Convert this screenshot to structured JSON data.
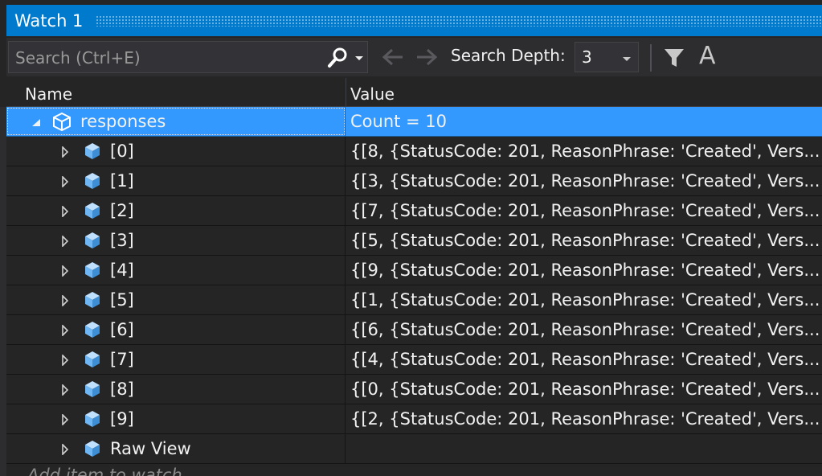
{
  "window": {
    "title": "Watch 1"
  },
  "toolbar": {
    "search_placeholder": "Search (Ctrl+E)",
    "search_value": "",
    "search_depth_label": "Search Depth:",
    "search_depth_value": "3"
  },
  "columns": {
    "name": "Name",
    "value": "Value"
  },
  "root": {
    "name": "responses",
    "value": "Count = 10"
  },
  "items": [
    {
      "name": "[0]",
      "value": "{[8, {StatusCode: 201, ReasonPhrase: 'Created', Vers..."
    },
    {
      "name": "[1]",
      "value": "{[3, {StatusCode: 201, ReasonPhrase: 'Created', Vers..."
    },
    {
      "name": "[2]",
      "value": "{[7, {StatusCode: 201, ReasonPhrase: 'Created', Vers..."
    },
    {
      "name": "[3]",
      "value": "{[5, {StatusCode: 201, ReasonPhrase: 'Created', Vers..."
    },
    {
      "name": "[4]",
      "value": "{[9, {StatusCode: 201, ReasonPhrase: 'Created', Vers..."
    },
    {
      "name": "[5]",
      "value": "{[1, {StatusCode: 201, ReasonPhrase: 'Created', Vers..."
    },
    {
      "name": "[6]",
      "value": "{[6, {StatusCode: 201, ReasonPhrase: 'Created', Vers..."
    },
    {
      "name": "[7]",
      "value": "{[4, {StatusCode: 201, ReasonPhrase: 'Created', Vers..."
    },
    {
      "name": "[8]",
      "value": "{[0, {StatusCode: 201, ReasonPhrase: 'Created', Vers..."
    },
    {
      "name": "[9]",
      "value": "{[2, {StatusCode: 201, ReasonPhrase: 'Created', Vers..."
    }
  ],
  "raw_view": {
    "name": "Raw View",
    "value": ""
  },
  "add_item_placeholder": "Add item to watch",
  "colors": {
    "accent": "#007acc",
    "selection": "#3399ff",
    "background": "#252526",
    "cube_icon": "#75beff"
  },
  "icons": {
    "search": "search-icon",
    "back": "arrow-left-icon",
    "forward": "arrow-right-icon",
    "filter": "filter-icon",
    "font": "font-icon",
    "expand": "expand-triangle-icon",
    "collapse": "collapse-triangle-icon",
    "object": "object-cube-icon"
  }
}
